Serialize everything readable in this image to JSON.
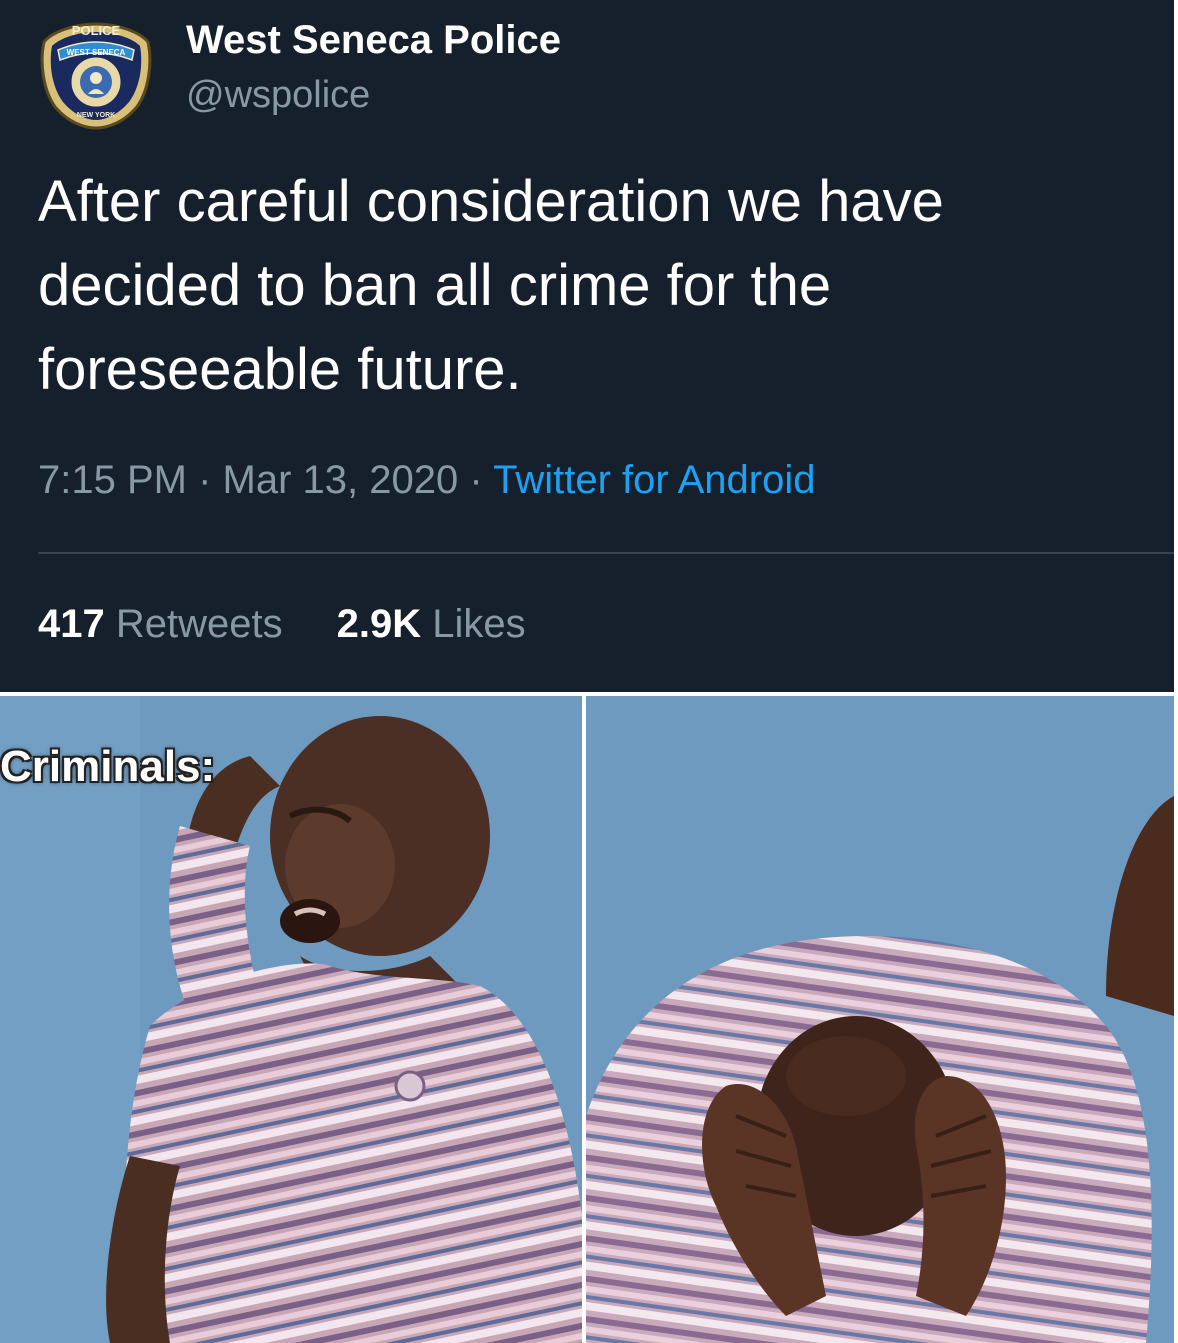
{
  "tweet": {
    "display_name": "West Seneca Police",
    "handle": "@wspolice",
    "avatar": {
      "icon": "police-badge-icon",
      "badge_top": "POLICE",
      "badge_ribbon": "WEST SENECA",
      "badge_bottom": "NEW YORK"
    },
    "text": "After careful consideration we have decided to ban all crime for the foreseeable future.",
    "time": "7:15 PM",
    "date": "Mar 13, 2020",
    "separator": "·",
    "source": "Twitter for Android",
    "retweets_count": "417",
    "retweets_label": "Retweets",
    "likes_count": "2.9K",
    "likes_label": "Likes"
  },
  "meme": {
    "caption": "Criminals:"
  },
  "colors": {
    "tweet_background": "#16202c",
    "text_primary": "#ffffff",
    "text_secondary": "#8899a6",
    "link": "#1da1f2",
    "meme_background": "#6f9ac0"
  }
}
